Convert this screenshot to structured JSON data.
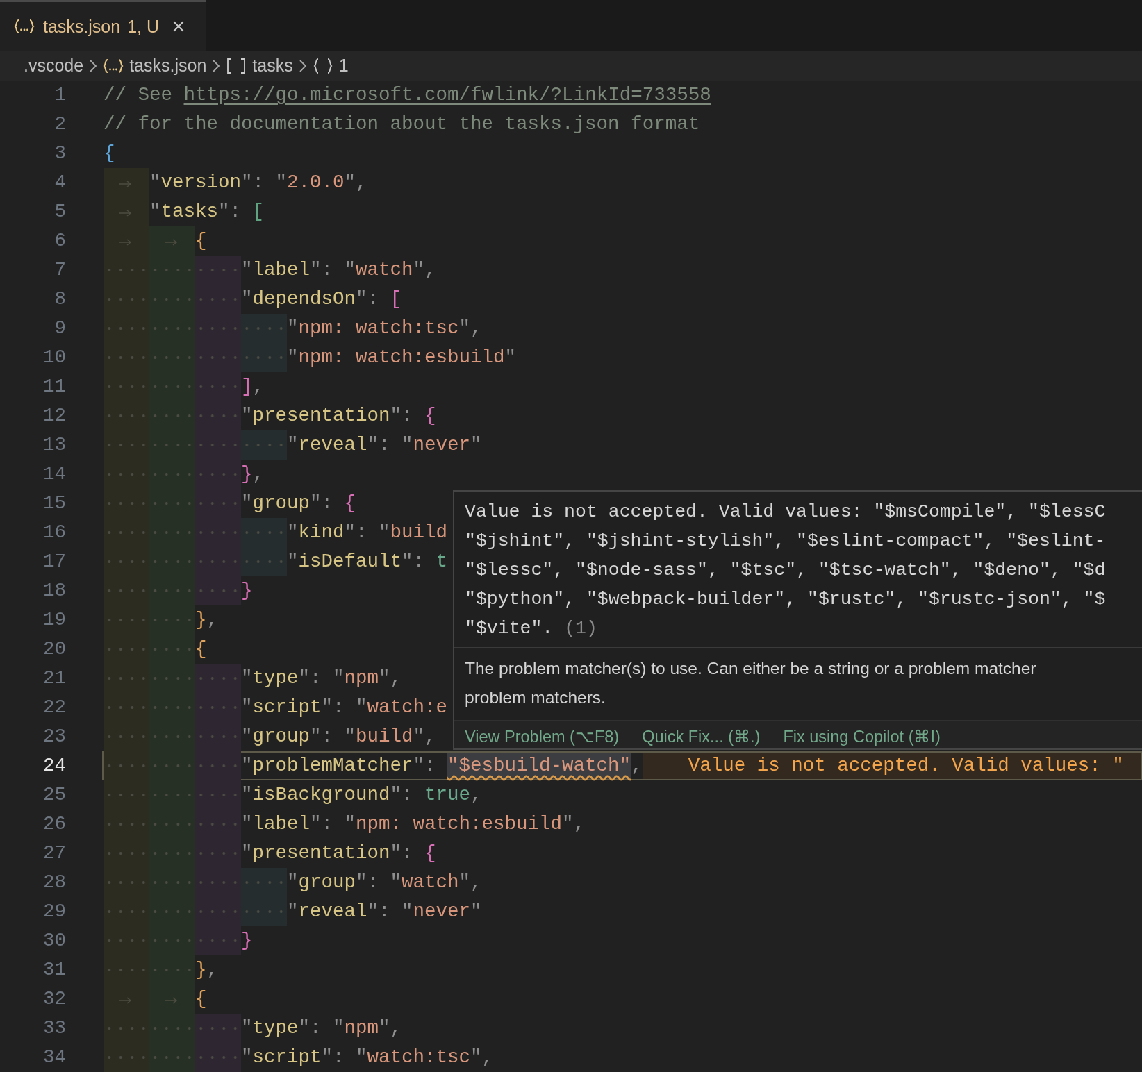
{
  "tab": {
    "label": "tasks.json",
    "status": "1, U",
    "selected": true
  },
  "breadcrumb": [
    {
      "kind": "folder",
      "label": ".vscode"
    },
    {
      "kind": "file",
      "label": "tasks.json"
    },
    {
      "kind": "array",
      "label": "tasks"
    },
    {
      "kind": "object",
      "label": "1"
    }
  ],
  "editor": {
    "lines": [
      {
        "number": "1",
        "current": false,
        "tokens": [
          {
            "kind": "comment",
            "text": "// See "
          },
          {
            "kind": "link",
            "text": "https://go.microsoft.com/fwlink/?LinkId=733558"
          }
        ]
      },
      {
        "number": "2",
        "current": false,
        "tokens": [
          {
            "kind": "comment",
            "text": "// for the documentation about the tasks.json format"
          }
        ]
      },
      {
        "number": "3",
        "current": false,
        "tokens": [
          {
            "kind": "bracket",
            "text": "{",
            "color": "#5da3d6"
          }
        ]
      },
      {
        "number": "4",
        "current": false,
        "indent": [
          {
            "tab": true
          }
        ],
        "tokens": [
          {
            "kind": "punct",
            "text": "\""
          },
          {
            "kind": "key",
            "text": "version"
          },
          {
            "kind": "punct",
            "text": "\": \""
          },
          {
            "kind": "string",
            "text": "2.0.0"
          },
          {
            "kind": "punct",
            "text": "\","
          }
        ]
      },
      {
        "number": "5",
        "current": false,
        "indent": [
          {
            "tab": true
          }
        ],
        "tokens": [
          {
            "kind": "punct",
            "text": "\""
          },
          {
            "kind": "key",
            "text": "tasks"
          },
          {
            "kind": "punct",
            "text": "\": "
          },
          {
            "kind": "bracket",
            "text": "[",
            "color": "#5fa381"
          }
        ]
      },
      {
        "number": "6",
        "current": false,
        "indent": [
          {
            "tab": true
          },
          {
            "tab": true
          }
        ],
        "tokens": [
          {
            "kind": "bracket",
            "text": "{",
            "color": "#e0a35c"
          }
        ]
      },
      {
        "number": "7",
        "current": false,
        "indent": [
          {
            "tab": false
          },
          {
            "tab": false
          },
          {
            "tab": false
          }
        ],
        "tokens": [
          {
            "kind": "punct",
            "text": "\""
          },
          {
            "kind": "key",
            "text": "label"
          },
          {
            "kind": "punct",
            "text": "\": \""
          },
          {
            "kind": "string",
            "text": "watch"
          },
          {
            "kind": "punct",
            "text": "\","
          }
        ]
      },
      {
        "number": "8",
        "current": false,
        "indent": [
          {
            "tab": false
          },
          {
            "tab": false
          },
          {
            "tab": false
          }
        ],
        "tokens": [
          {
            "kind": "punct",
            "text": "\""
          },
          {
            "kind": "key",
            "text": "dependsOn"
          },
          {
            "kind": "punct",
            "text": "\": "
          },
          {
            "kind": "bracket",
            "text": "[",
            "color": "#d66fb4"
          }
        ]
      },
      {
        "number": "9",
        "current": false,
        "indent": [
          {
            "tab": false
          },
          {
            "tab": false
          },
          {
            "tab": false
          },
          {
            "tab": false
          }
        ],
        "tokens": [
          {
            "kind": "punct",
            "text": "\""
          },
          {
            "kind": "string",
            "text": "npm: watch:tsc"
          },
          {
            "kind": "punct",
            "text": "\","
          }
        ]
      },
      {
        "number": "10",
        "current": false,
        "indent": [
          {
            "tab": false
          },
          {
            "tab": false
          },
          {
            "tab": false
          },
          {
            "tab": false
          }
        ],
        "tokens": [
          {
            "kind": "punct",
            "text": "\""
          },
          {
            "kind": "string",
            "text": "npm: watch:esbuild"
          },
          {
            "kind": "punct",
            "text": "\""
          }
        ]
      },
      {
        "number": "11",
        "current": false,
        "indent": [
          {
            "tab": false
          },
          {
            "tab": false
          },
          {
            "tab": false
          }
        ],
        "tokens": [
          {
            "kind": "bracket",
            "text": "]",
            "color": "#d66fb4"
          },
          {
            "kind": "punct",
            "text": ","
          }
        ]
      },
      {
        "number": "12",
        "current": false,
        "indent": [
          {
            "tab": false
          },
          {
            "tab": false
          },
          {
            "tab": false
          }
        ],
        "tokens": [
          {
            "kind": "punct",
            "text": "\""
          },
          {
            "kind": "key",
            "text": "presentation"
          },
          {
            "kind": "punct",
            "text": "\": "
          },
          {
            "kind": "bracket",
            "text": "{",
            "color": "#d66fb4"
          }
        ]
      },
      {
        "number": "13",
        "current": false,
        "indent": [
          {
            "tab": false
          },
          {
            "tab": false
          },
          {
            "tab": false
          },
          {
            "tab": false
          }
        ],
        "tokens": [
          {
            "kind": "punct",
            "text": "\""
          },
          {
            "kind": "key",
            "text": "reveal"
          },
          {
            "kind": "punct",
            "text": "\": \""
          },
          {
            "kind": "string",
            "text": "never"
          },
          {
            "kind": "punct",
            "text": "\""
          }
        ]
      },
      {
        "number": "14",
        "current": false,
        "indent": [
          {
            "tab": false
          },
          {
            "tab": false
          },
          {
            "tab": false
          }
        ],
        "tokens": [
          {
            "kind": "bracket",
            "text": "}",
            "color": "#d66fb4"
          },
          {
            "kind": "punct",
            "text": ","
          }
        ]
      },
      {
        "number": "15",
        "current": false,
        "indent": [
          {
            "tab": false
          },
          {
            "tab": false
          },
          {
            "tab": false
          }
        ],
        "tokens": [
          {
            "kind": "punct",
            "text": "\""
          },
          {
            "kind": "key",
            "text": "group"
          },
          {
            "kind": "punct",
            "text": "\": "
          },
          {
            "kind": "bracket",
            "text": "{",
            "color": "#d66fb4"
          }
        ]
      },
      {
        "number": "16",
        "current": false,
        "indent": [
          {
            "tab": false
          },
          {
            "tab": false
          },
          {
            "tab": false
          },
          {
            "tab": false
          }
        ],
        "tokens": [
          {
            "kind": "punct",
            "text": "\""
          },
          {
            "kind": "key",
            "text": "kind"
          },
          {
            "kind": "punct",
            "text": "\": \""
          },
          {
            "kind": "string",
            "text": "build"
          }
        ]
      },
      {
        "number": "17",
        "current": false,
        "indent": [
          {
            "tab": false
          },
          {
            "tab": false
          },
          {
            "tab": false
          },
          {
            "tab": false
          }
        ],
        "tokens": [
          {
            "kind": "punct",
            "text": "\""
          },
          {
            "kind": "key",
            "text": "isDefault"
          },
          {
            "kind": "punct",
            "text": "\": "
          },
          {
            "kind": "keyword",
            "text": "t"
          }
        ]
      },
      {
        "number": "18",
        "current": false,
        "indent": [
          {
            "tab": false
          },
          {
            "tab": false
          },
          {
            "tab": false
          }
        ],
        "tokens": [
          {
            "kind": "bracket",
            "text": "}",
            "color": "#d66fb4"
          }
        ]
      },
      {
        "number": "19",
        "current": false,
        "indent": [
          {
            "tab": false
          },
          {
            "tab": false
          }
        ],
        "tokens": [
          {
            "kind": "bracket",
            "text": "}",
            "color": "#e0a35c"
          },
          {
            "kind": "punct",
            "text": ","
          }
        ]
      },
      {
        "number": "20",
        "current": false,
        "indent": [
          {
            "tab": false
          },
          {
            "tab": false
          }
        ],
        "tokens": [
          {
            "kind": "bracket",
            "text": "{",
            "color": "#e0a35c"
          }
        ]
      },
      {
        "number": "21",
        "current": false,
        "indent": [
          {
            "tab": false
          },
          {
            "tab": false
          },
          {
            "tab": false
          }
        ],
        "tokens": [
          {
            "kind": "punct",
            "text": "\""
          },
          {
            "kind": "key",
            "text": "type"
          },
          {
            "kind": "punct",
            "text": "\": \""
          },
          {
            "kind": "string",
            "text": "npm"
          },
          {
            "kind": "punct",
            "text": "\","
          }
        ]
      },
      {
        "number": "22",
        "current": false,
        "indent": [
          {
            "tab": false
          },
          {
            "tab": false
          },
          {
            "tab": false
          }
        ],
        "tokens": [
          {
            "kind": "punct",
            "text": "\""
          },
          {
            "kind": "key",
            "text": "script"
          },
          {
            "kind": "punct",
            "text": "\": \""
          },
          {
            "kind": "string",
            "text": "watch:e"
          }
        ]
      },
      {
        "number": "23",
        "current": false,
        "indent": [
          {
            "tab": false
          },
          {
            "tab": false
          },
          {
            "tab": false
          }
        ],
        "tokens": [
          {
            "kind": "punct",
            "text": "\""
          },
          {
            "kind": "key",
            "text": "group"
          },
          {
            "kind": "punct",
            "text": "\": \""
          },
          {
            "kind": "string",
            "text": "build"
          },
          {
            "kind": "punct",
            "text": "\","
          }
        ]
      },
      {
        "number": "24",
        "current": true,
        "indent": [
          {
            "tab": false
          },
          {
            "tab": false
          },
          {
            "tab": false
          }
        ],
        "tokens": [
          {
            "kind": "punct",
            "text": "\""
          },
          {
            "kind": "key",
            "text": "problemMatcher"
          },
          {
            "kind": "punct",
            "text": "\": "
          },
          {
            "kind": "error",
            "text": "\"$esbuild-watch\""
          },
          {
            "kind": "punct",
            "text": ","
          }
        ],
        "diagnostic": "Value is not accepted. Valid values: \""
      },
      {
        "number": "25",
        "current": false,
        "indent": [
          {
            "tab": false
          },
          {
            "tab": false
          },
          {
            "tab": false
          }
        ],
        "tokens": [
          {
            "kind": "punct",
            "text": "\""
          },
          {
            "kind": "key",
            "text": "isBackground"
          },
          {
            "kind": "punct",
            "text": "\": "
          },
          {
            "kind": "keyword",
            "text": "true"
          },
          {
            "kind": "punct",
            "text": ","
          }
        ]
      },
      {
        "number": "26",
        "current": false,
        "indent": [
          {
            "tab": false
          },
          {
            "tab": false
          },
          {
            "tab": false
          }
        ],
        "tokens": [
          {
            "kind": "punct",
            "text": "\""
          },
          {
            "kind": "key",
            "text": "label"
          },
          {
            "kind": "punct",
            "text": "\": \""
          },
          {
            "kind": "string",
            "text": "npm: watch:esbuild"
          },
          {
            "kind": "punct",
            "text": "\","
          }
        ]
      },
      {
        "number": "27",
        "current": false,
        "indent": [
          {
            "tab": false
          },
          {
            "tab": false
          },
          {
            "tab": false
          }
        ],
        "tokens": [
          {
            "kind": "punct",
            "text": "\""
          },
          {
            "kind": "key",
            "text": "presentation"
          },
          {
            "kind": "punct",
            "text": "\": "
          },
          {
            "kind": "bracket",
            "text": "{",
            "color": "#d66fb4"
          }
        ]
      },
      {
        "number": "28",
        "current": false,
        "indent": [
          {
            "tab": false
          },
          {
            "tab": false
          },
          {
            "tab": false
          },
          {
            "tab": false
          }
        ],
        "tokens": [
          {
            "kind": "punct",
            "text": "\""
          },
          {
            "kind": "key",
            "text": "group"
          },
          {
            "kind": "punct",
            "text": "\": \""
          },
          {
            "kind": "string",
            "text": "watch"
          },
          {
            "kind": "punct",
            "text": "\","
          }
        ]
      },
      {
        "number": "29",
        "current": false,
        "indent": [
          {
            "tab": false
          },
          {
            "tab": false
          },
          {
            "tab": false
          },
          {
            "tab": false
          }
        ],
        "tokens": [
          {
            "kind": "punct",
            "text": "\""
          },
          {
            "kind": "key",
            "text": "reveal"
          },
          {
            "kind": "punct",
            "text": "\": \""
          },
          {
            "kind": "string",
            "text": "never"
          },
          {
            "kind": "punct",
            "text": "\""
          }
        ]
      },
      {
        "number": "30",
        "current": false,
        "indent": [
          {
            "tab": false
          },
          {
            "tab": false
          },
          {
            "tab": false
          }
        ],
        "tokens": [
          {
            "kind": "bracket",
            "text": "}",
            "color": "#d66fb4"
          }
        ]
      },
      {
        "number": "31",
        "current": false,
        "indent": [
          {
            "tab": false
          },
          {
            "tab": false
          }
        ],
        "tokens": [
          {
            "kind": "bracket",
            "text": "}",
            "color": "#e0a35c"
          },
          {
            "kind": "punct",
            "text": ","
          }
        ]
      },
      {
        "number": "32",
        "current": false,
        "indent": [
          {
            "tab": true
          },
          {
            "tab": true
          }
        ],
        "tokens": [
          {
            "kind": "bracket",
            "text": "{",
            "color": "#e0a35c"
          }
        ]
      },
      {
        "number": "33",
        "current": false,
        "indent": [
          {
            "tab": false
          },
          {
            "tab": false
          },
          {
            "tab": false
          }
        ],
        "tokens": [
          {
            "kind": "punct",
            "text": "\""
          },
          {
            "kind": "key",
            "text": "type"
          },
          {
            "kind": "punct",
            "text": "\": \""
          },
          {
            "kind": "string",
            "text": "npm"
          },
          {
            "kind": "punct",
            "text": "\","
          }
        ]
      },
      {
        "number": "34",
        "current": false,
        "indent": [
          {
            "tab": false
          },
          {
            "tab": false
          },
          {
            "tab": false
          }
        ],
        "tokens": [
          {
            "kind": "punct",
            "text": "\""
          },
          {
            "kind": "key",
            "text": "script"
          },
          {
            "kind": "punct",
            "text": "\": \""
          },
          {
            "kind": "string",
            "text": "watch:tsc"
          },
          {
            "kind": "punct",
            "text": "\","
          }
        ]
      }
    ]
  },
  "hover": {
    "message_lines": [
      "Value is not accepted. Valid values: \"$msCompile\", \"$lessC",
      "\"$jshint\", \"$jshint-stylish\", \"$eslint-compact\", \"$eslint-",
      "\"$lessc\", \"$node-sass\", \"$tsc\", \"$tsc-watch\", \"$deno\", \"$d",
      "\"$python\", \"$webpack-builder\", \"$rustc\", \"$rustc-json\", \"$",
      "\"$vite\"."
    ],
    "code": "(1)",
    "description_lines": [
      "The problem matcher(s) to use. Can either be a string or a problem matcher",
      "problem matchers."
    ],
    "actions": [
      "View Problem (⌥F8)",
      "Quick Fix... (⌘.)",
      "Fix using Copilot (⌘I)"
    ]
  }
}
